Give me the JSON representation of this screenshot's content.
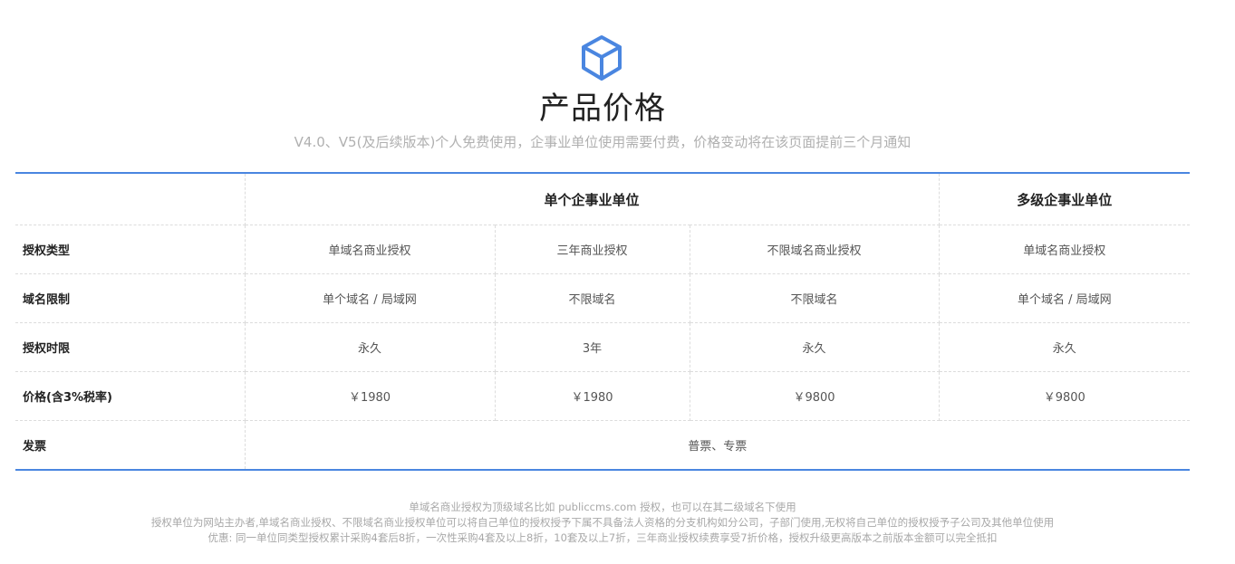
{
  "header": {
    "title": "产品价格",
    "subtitle": "V4.0、V5(及后续版本)个人免费使用，企事业单位使用需要付费，价格变动将在该页面提前三个月通知",
    "icon": "cube-icon",
    "accent": "#4a86e0"
  },
  "table": {
    "groups": {
      "single": "单个企事业单位",
      "multi": "多级企事业单位"
    },
    "rows": [
      {
        "label": "授权类型",
        "cells": [
          "单域名商业授权",
          "三年商业授权",
          "不限域名商业授权",
          "单域名商业授权"
        ]
      },
      {
        "label": "域名限制",
        "cells": [
          "单个域名 / 局域网",
          "不限域名",
          "不限域名",
          "单个域名 / 局域网"
        ]
      },
      {
        "label": "授权时限",
        "cells": [
          "永久",
          "3年",
          "永久",
          "永久"
        ]
      },
      {
        "label": "价格(含3%税率)",
        "cells": [
          "￥1980",
          "￥1980",
          "￥9800",
          "￥9800"
        ]
      }
    ],
    "invoice": {
      "label": "发票",
      "value": "普票、专票"
    }
  },
  "notes": [
    "单域名商业授权为顶级域名比如 publiccms.com 授权，也可以在其二级域名下使用",
    "授权单位为网站主办者,单域名商业授权、不限域名商业授权单位可以将自己单位的授权授予下属不具备法人资格的分支机构如分公司，子部门使用,无权将自己单位的授权授予子公司及其他单位使用",
    "优惠: 同一单位同类型授权累计采购4套后8折，一次性采购4套及以上8折，10套及以上7折，三年商业授权续费享受7折价格，授权升级更高版本之前版本金额可以完全抵扣"
  ]
}
